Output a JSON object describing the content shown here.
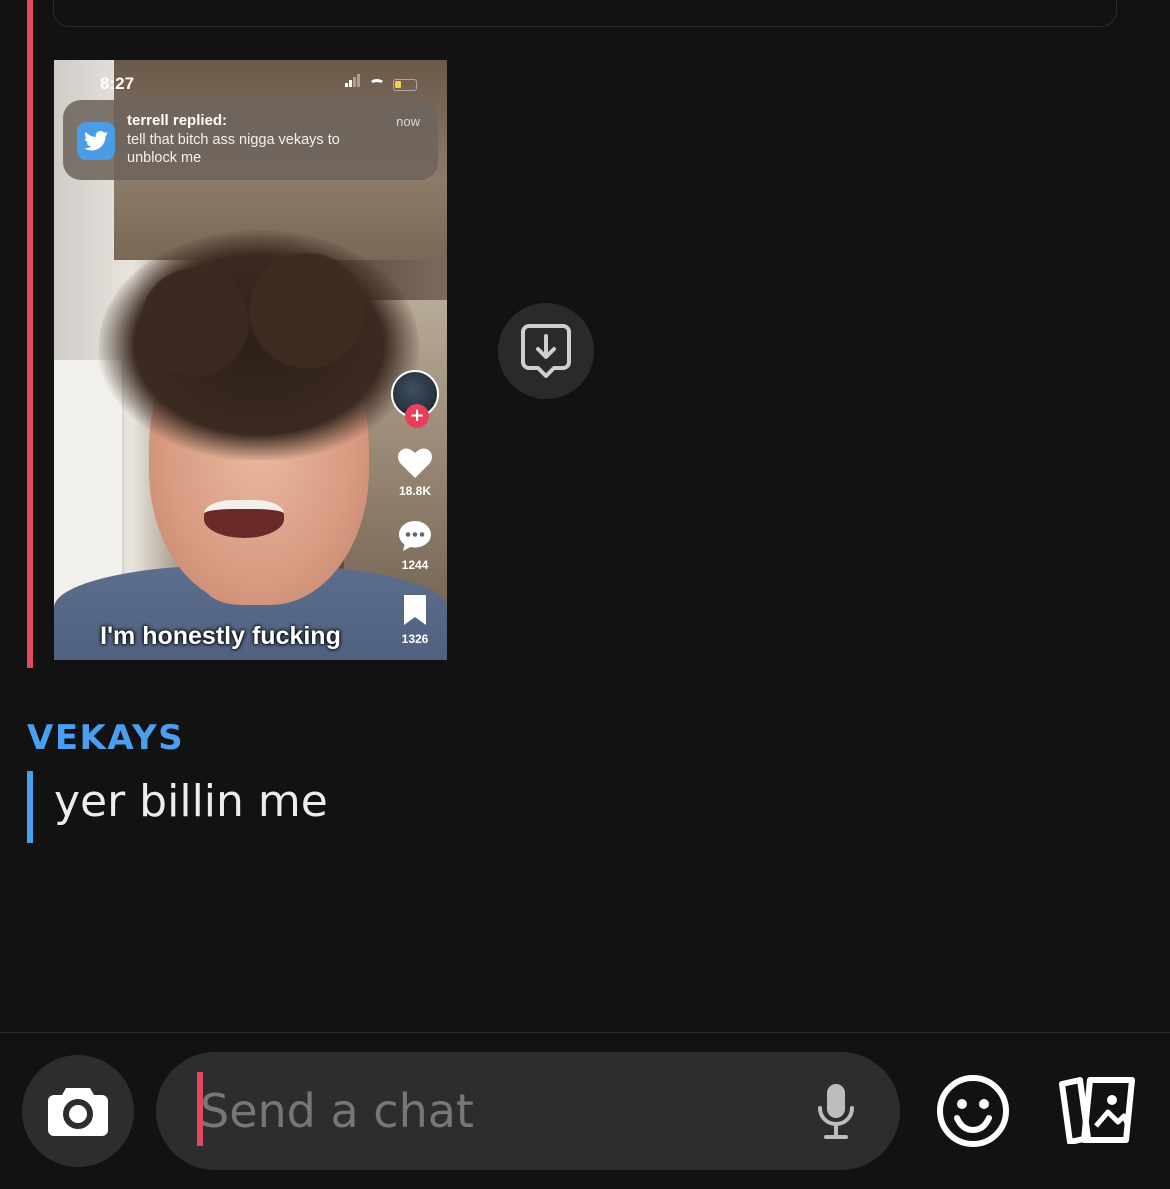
{
  "snap": {
    "status_time": "8:27",
    "notification": {
      "title": "terrell replied:",
      "body": "tell that bitch ass nigga vekays to unblock me",
      "time": "now"
    },
    "likes": "18.8K",
    "comments": "1244",
    "saves": "1326",
    "caption": "I'm honestly fucking"
  },
  "message": {
    "sender": "VEKAYS",
    "text": "yer billin me"
  },
  "composer": {
    "placeholder": "Send a chat"
  },
  "colors": {
    "background": "#121212",
    "friend_accent": "#e04a5f",
    "sender_accent": "#4a9ff0"
  },
  "icons": [
    "save-icon",
    "camera-icon",
    "microphone-icon",
    "emoji-icon",
    "cards-icon"
  ]
}
